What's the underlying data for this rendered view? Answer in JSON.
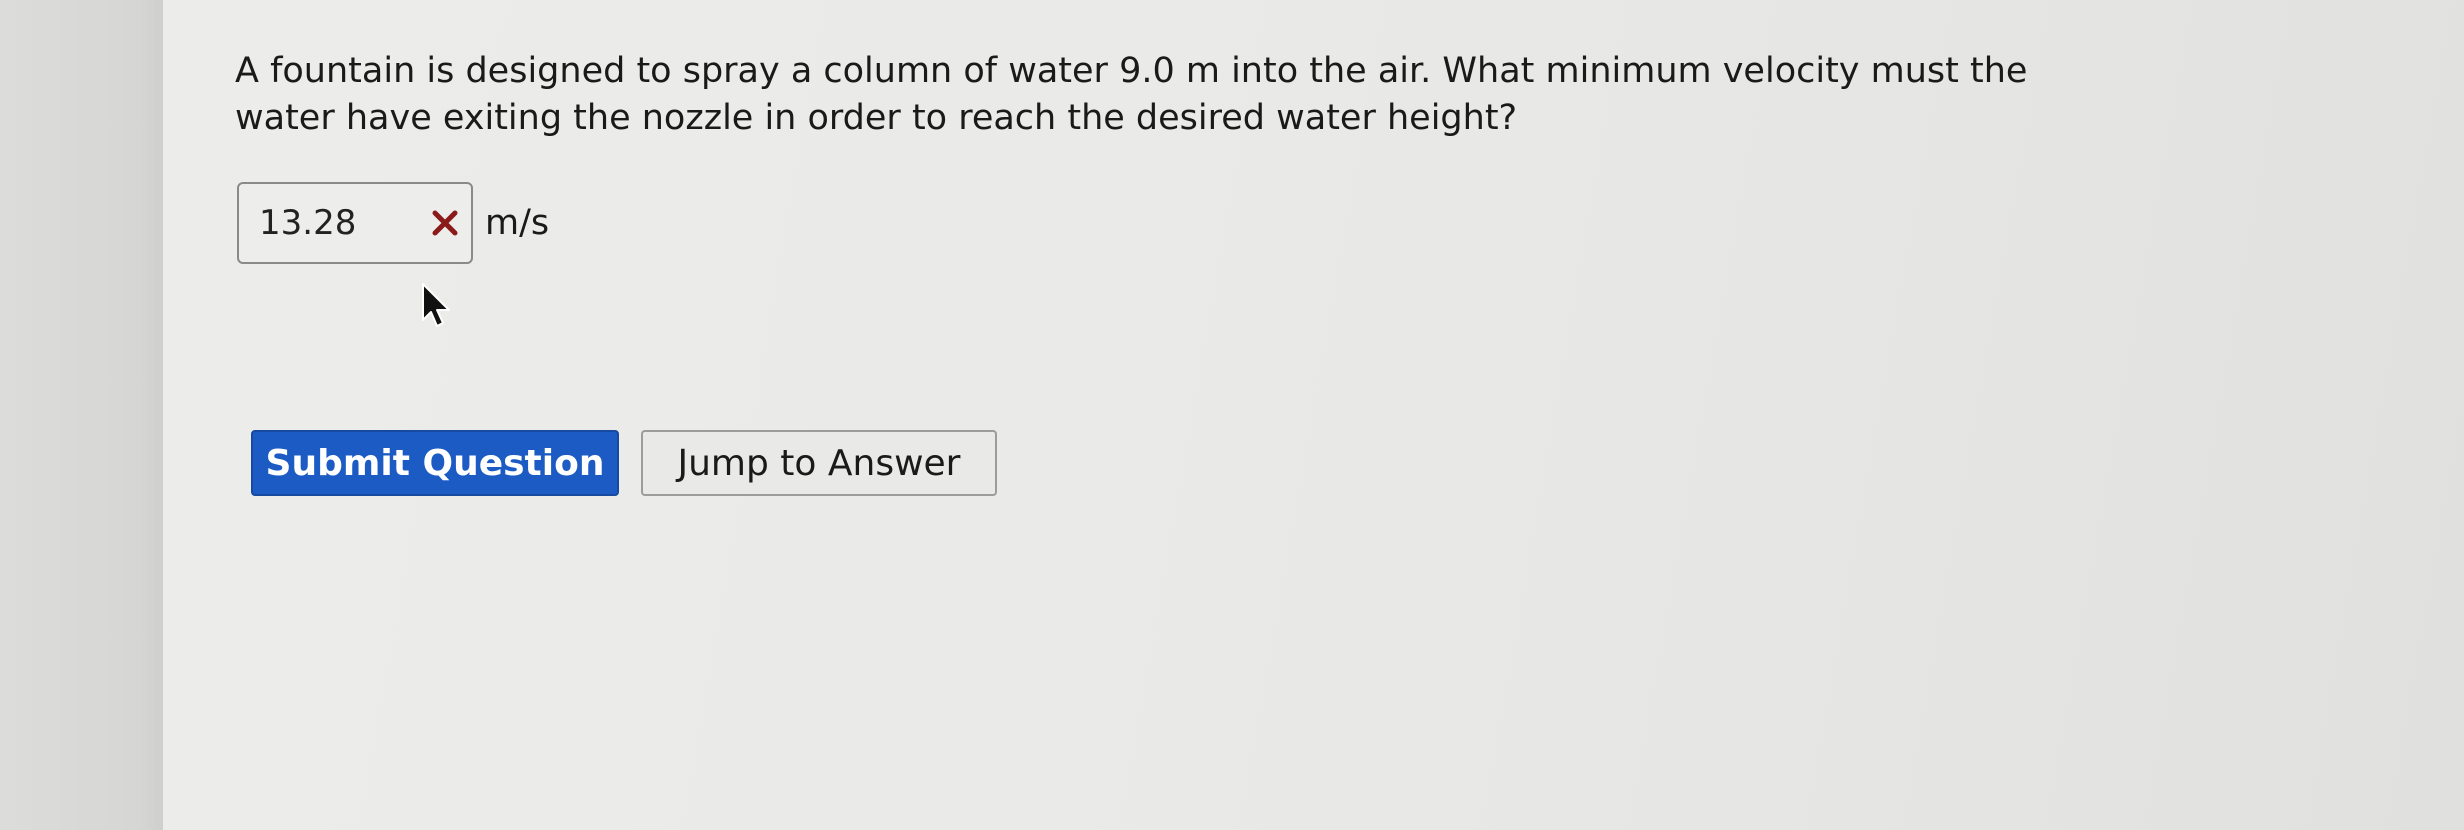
{
  "question": {
    "text_line1": "A fountain is designed to spray a column of water 9.0 m into the air. What minimum velocity must the",
    "text_line2": "water have exiting the nozzle in order to reach the desired water height?"
  },
  "answer": {
    "value": "13.28",
    "unit": "m/s",
    "status_icon": "x-icon",
    "status_color": "#8b1a1a"
  },
  "buttons": {
    "submit_label": "Submit Question",
    "jump_label": "Jump to Answer"
  },
  "colors": {
    "primary": "#1d5bc4"
  }
}
